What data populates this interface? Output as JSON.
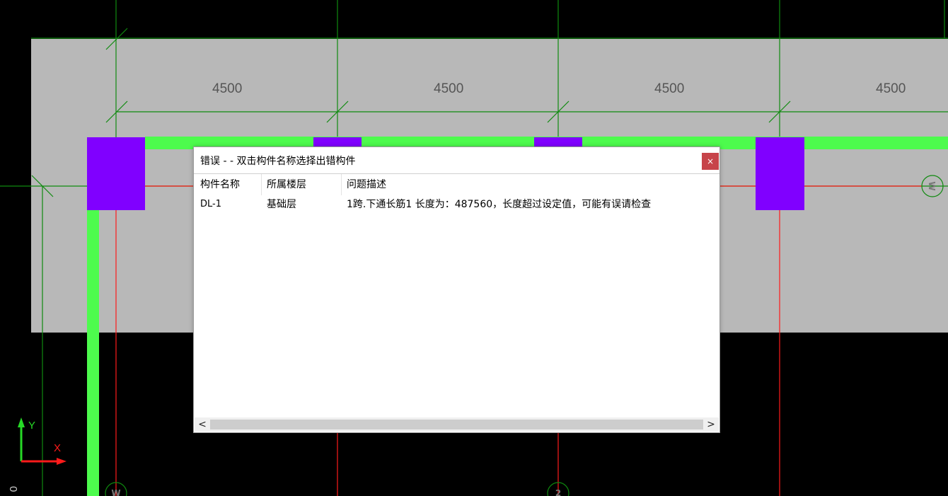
{
  "drawing": {
    "dimensions": [
      "4500",
      "4500",
      "4500",
      "4500"
    ],
    "axis_bubbles": {
      "left_bottom": "W",
      "mid_bottom": "2",
      "right_edge": "W"
    },
    "ucs": {
      "y_label": "Y",
      "x_label": "X"
    },
    "corner_char": "0",
    "colors": {
      "background": "#000000",
      "slab": "#b8b8b8",
      "axis_green": "#0f8a0f",
      "axis_red": "#ff1a1a",
      "beam": "#4dfb4d",
      "column": "#8000ff"
    }
  },
  "dialog": {
    "title": "错误 - - 双击构件名称选择出错构件",
    "close_label": "×",
    "columns": [
      "构件名称",
      "所属楼层",
      "问题描述"
    ],
    "rows": [
      {
        "name": "DL-1",
        "floor": "基础层",
        "desc": "1跨.下通长筋1 长度为：487560，长度超过设定值，可能有误请检查"
      }
    ],
    "scroll_left": "<",
    "scroll_right": ">"
  }
}
